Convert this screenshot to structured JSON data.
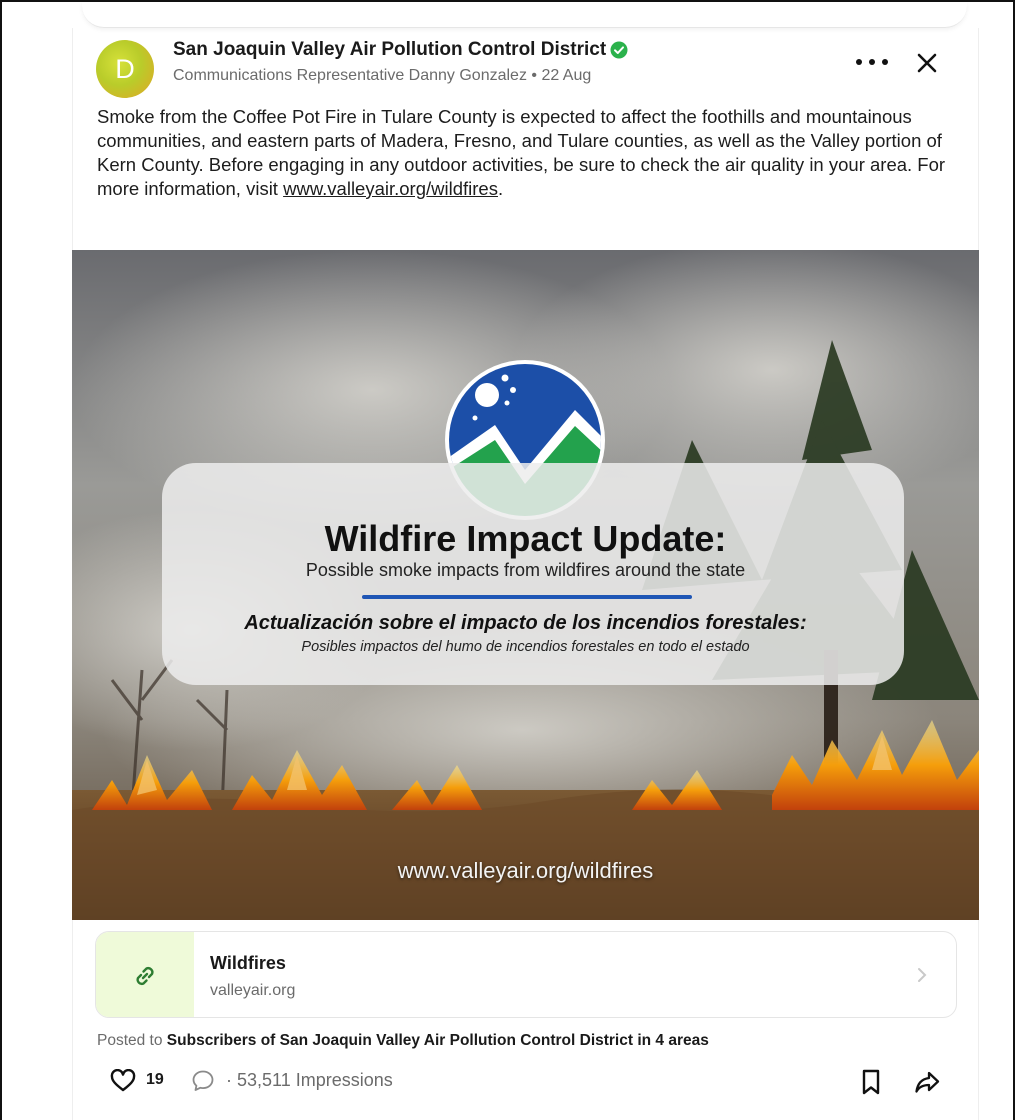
{
  "post": {
    "avatar_letter": "D",
    "author": "San Joaquin Valley Air Pollution Control District",
    "meta": "Communications Representative Danny Gonzalez • 22 Aug",
    "body_text": "Smoke from the Coffee Pot Fire in Tulare County is expected to affect the foothills and mountainous communities, and eastern parts of Madera, Fresno, and Tulare counties, as well as the Valley portion of Kern County. Before engaging in any outdoor activities, be sure to check the air quality in your area. For more information, visit ",
    "body_link": "www.valleyair.org/wildfires",
    "body_end": "."
  },
  "image": {
    "title": "Wildfire Impact Update:",
    "subtitle": "Possible smoke impacts from wildfires around the state",
    "es_title": "Actualización sobre el impacto de los incendios forestales:",
    "es_subtitle": "Posibles impactos del humo de incendios forestales en todo el estado",
    "url": "www.valleyair.org/wildfires"
  },
  "link_preview": {
    "title": "Wildfires",
    "domain": "valleyair.org"
  },
  "posted_to": {
    "prefix": "Posted to ",
    "audience": "Subscribers of San Joaquin Valley Air Pollution Control District in 4 areas"
  },
  "actions": {
    "like_count": "19",
    "impressions": "· 53,511 Impressions"
  },
  "icons": {
    "verified": "verified-check-icon",
    "more": "more-options-icon",
    "close": "close-icon",
    "link": "link-icon",
    "chevron": "chevron-right-icon",
    "like": "heart-icon",
    "comment": "comment-icon",
    "bookmark": "bookmark-icon",
    "share": "share-icon"
  },
  "colors": {
    "verified_green": "#2bb24c",
    "link_thumb_bg": "#effad9",
    "link_icon": "#2e7d32",
    "logo_blue": "#1c4fa8",
    "logo_green": "#23a24d",
    "divider_blue": "#1f56b5"
  }
}
